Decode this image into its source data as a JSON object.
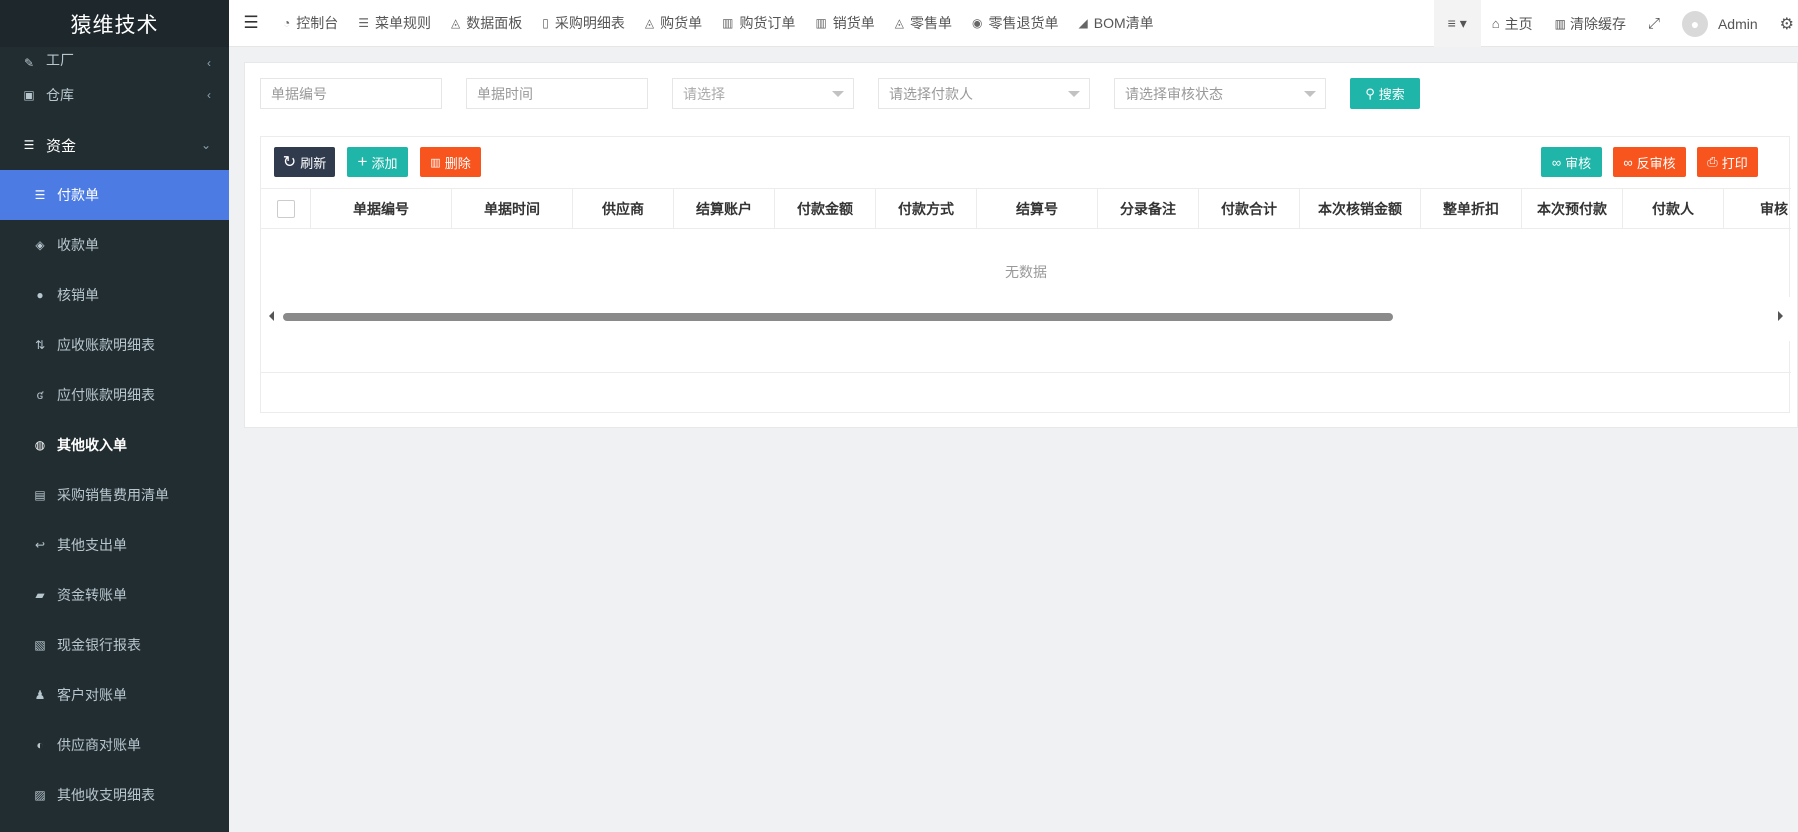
{
  "app": {
    "logo": "猿维技术"
  },
  "sidebar": {
    "items": [
      {
        "label": "工厂",
        "icon": "tool-icon",
        "glyph": "✎",
        "kind": "partial",
        "chev": "‹"
      },
      {
        "label": "仓库",
        "icon": "warehouse-icon",
        "glyph": "▣",
        "kind": "top",
        "chev": "‹"
      },
      {
        "label": "资金",
        "icon": "database-icon",
        "glyph": "☰",
        "kind": "group",
        "chev": "⌄"
      },
      {
        "label": "付款单",
        "icon": "database-icon",
        "glyph": "☰",
        "kind": "active"
      },
      {
        "label": "收款单",
        "icon": "diamond-icon",
        "glyph": "◈",
        "kind": "sub"
      },
      {
        "label": "核销单",
        "icon": "apple-icon",
        "glyph": "●",
        "kind": "sub"
      },
      {
        "label": "应收账款明细表",
        "icon": "exchange-icon",
        "glyph": "⇅",
        "kind": "sub"
      },
      {
        "label": "应付账款明细表",
        "icon": "graph-icon",
        "glyph": "ʛ",
        "kind": "sub"
      },
      {
        "label": "其他收入单",
        "icon": "shopping-icon",
        "glyph": "◍",
        "kind": "bold"
      },
      {
        "label": "采购销售费用清单",
        "icon": "list-icon",
        "glyph": "▤",
        "kind": "sub"
      },
      {
        "label": "其他支出单",
        "icon": "reply-icon",
        "glyph": "↩",
        "kind": "sub"
      },
      {
        "label": "资金转账单",
        "icon": "book-icon",
        "glyph": "▰",
        "kind": "sub"
      },
      {
        "label": "现金银行报表",
        "icon": "bank-icon",
        "glyph": "▧",
        "kind": "sub"
      },
      {
        "label": "客户对账单",
        "icon": "bell-icon",
        "glyph": "♟",
        "kind": "sub"
      },
      {
        "label": "供应商对账单",
        "icon": "circle-half-icon",
        "glyph": "◐",
        "kind": "sub"
      },
      {
        "label": "其他收支明细表",
        "icon": "image-icon",
        "glyph": "▨",
        "kind": "sub"
      }
    ]
  },
  "topnav": {
    "tabs": [
      {
        "label": "控制台",
        "icon": "dashboard-icon",
        "glyph": "◔"
      },
      {
        "label": "菜单规则",
        "icon": "bars-icon",
        "glyph": "☰"
      },
      {
        "label": "数据面板",
        "icon": "area-chart-icon",
        "glyph": "◬"
      },
      {
        "label": "采购明细表",
        "icon": "file-icon",
        "glyph": "▯"
      },
      {
        "label": "购货单",
        "icon": "area-chart-icon",
        "glyph": "◬"
      },
      {
        "label": "购货订单",
        "icon": "bar-chart-icon",
        "glyph": "▥"
      },
      {
        "label": "销货单",
        "icon": "bar-chart-icon",
        "glyph": "▥"
      },
      {
        "label": "零售单",
        "icon": "area-chart-icon",
        "glyph": "◬"
      },
      {
        "label": "零售退货单",
        "icon": "arrow-circle-icon",
        "glyph": "◉"
      },
      {
        "label": "BOM清单",
        "icon": "eraser-icon",
        "glyph": "◢"
      }
    ],
    "right": {
      "list_icon": "≡ ▾",
      "home": "主页",
      "home_glyph": "⌂",
      "clear": "清除缓存",
      "clear_glyph": "▥",
      "fullscreen_glyph": "⤢",
      "admin": "Admin",
      "settings_glyph": "⚙"
    }
  },
  "search": {
    "doc_no_placeholder": "单据编号",
    "doc_time_placeholder": "单据时间",
    "select_placeholder": "请选择",
    "payer_placeholder": "请选择付款人",
    "audit_placeholder": "请选择审核状态",
    "search_label": "搜索",
    "search_glyph": "⚲"
  },
  "toolbar": {
    "refresh": "刷新",
    "refresh_glyph": "↻",
    "add": "添加",
    "add_glyph": "+",
    "delete": "删除",
    "delete_glyph": "▥",
    "audit": "审核",
    "audit_glyph": "∞",
    "unaudit": "反审核",
    "unaudit_glyph": "∞",
    "print": "打印",
    "print_glyph": "⎙"
  },
  "table": {
    "columns": [
      {
        "label": "单据编号",
        "w": 141
      },
      {
        "label": "单据时间",
        "w": 121
      },
      {
        "label": "供应商",
        "w": 101
      },
      {
        "label": "结算账户",
        "w": 101
      },
      {
        "label": "付款金额",
        "w": 101
      },
      {
        "label": "付款方式",
        "w": 101
      },
      {
        "label": "结算号",
        "w": 121
      },
      {
        "label": "分录备注",
        "w": 101
      },
      {
        "label": "付款合计",
        "w": 101
      },
      {
        "label": "本次核销金额",
        "w": 121
      },
      {
        "label": "整单折扣",
        "w": 101
      },
      {
        "label": "本次预付款",
        "w": 101
      },
      {
        "label": "付款人",
        "w": 101
      },
      {
        "label": "审核",
        "w": 101
      }
    ],
    "empty_text": "无数据"
  },
  "colors": {
    "sidebar": "#222d32",
    "active": "#4c7ce3",
    "green": "#1fb5a8",
    "orange": "#f8551e",
    "dark": "#313b4e"
  }
}
